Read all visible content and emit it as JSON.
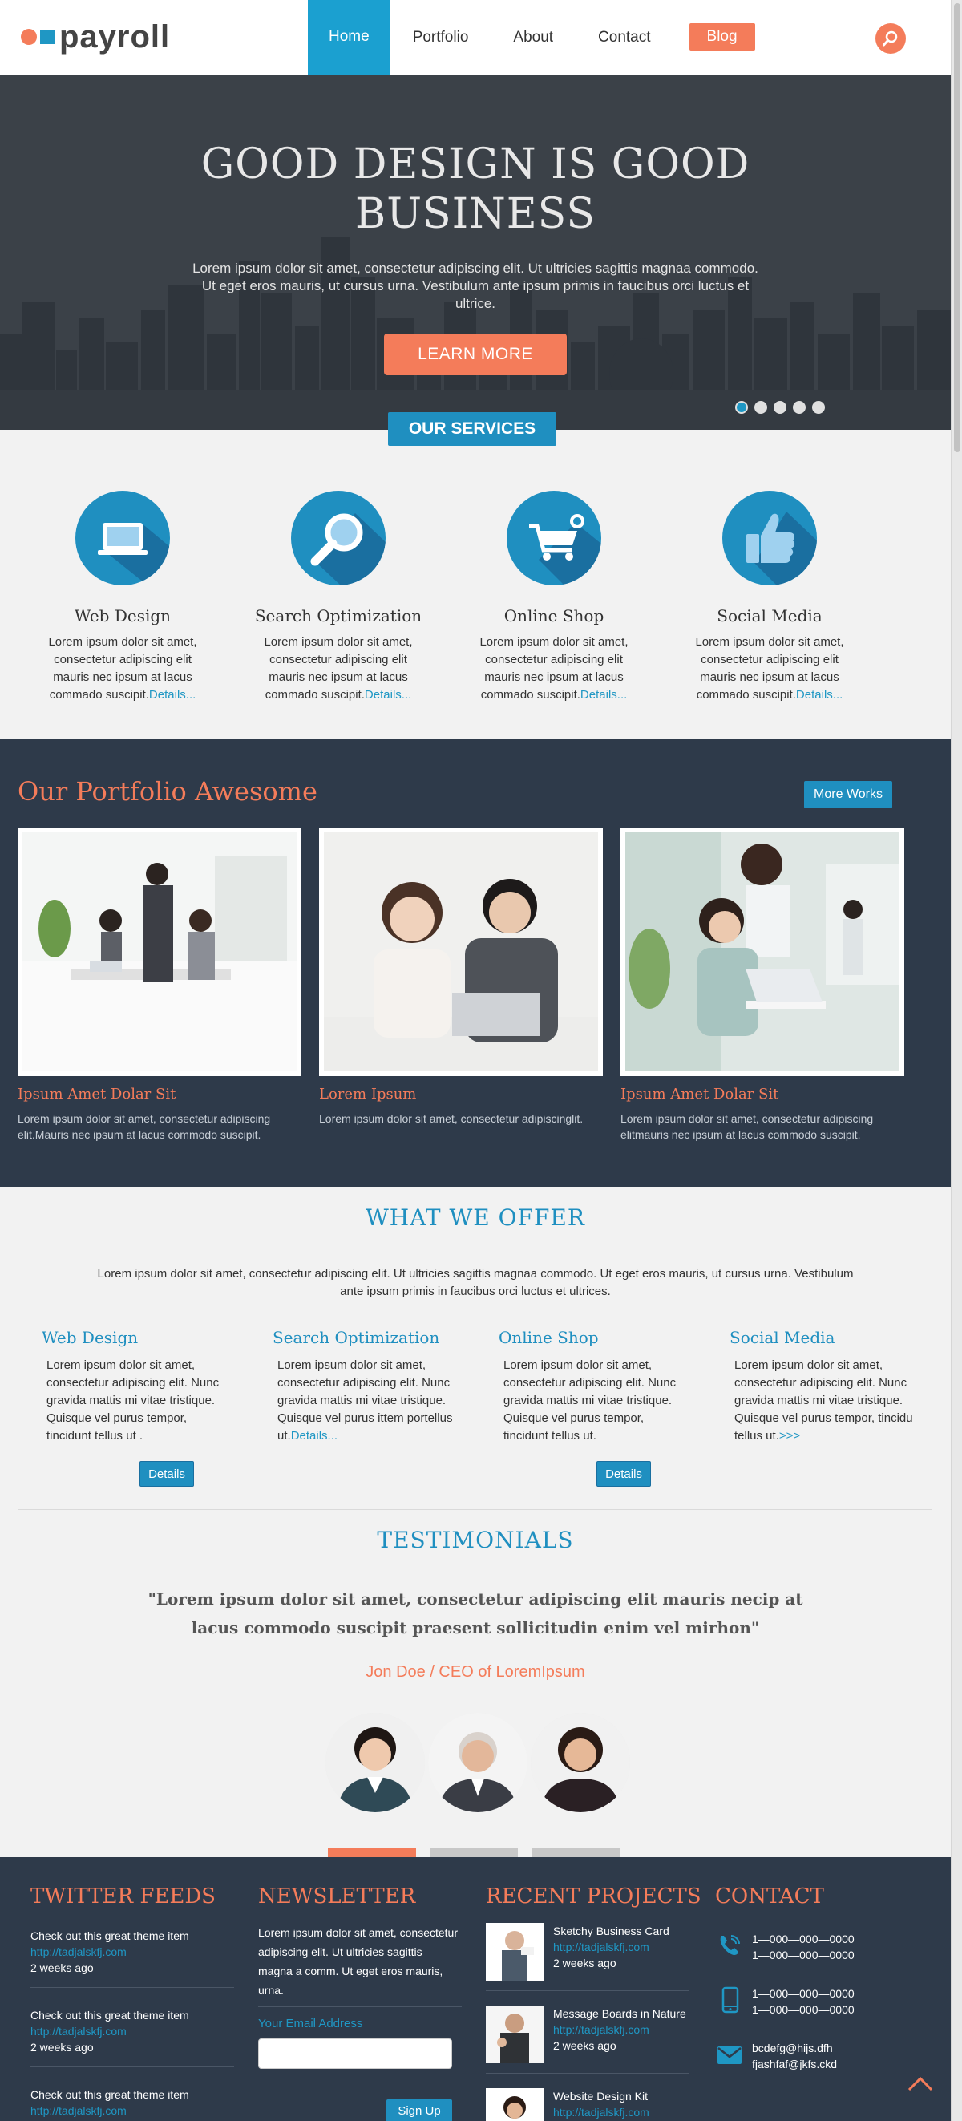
{
  "brand": {
    "name": "payroll"
  },
  "nav": {
    "home": "Home",
    "portfolio": "Portfolio",
    "about": "About",
    "contact": "Contact",
    "blog": "Blog"
  },
  "hero": {
    "title_line1": "GOOD DESIGN IS GOOD",
    "title_line2": "BUSINESS",
    "text": "Lorem ipsum dolor sit amet, consectetur adipiscing elit. Ut ultricies sagittis magnaa commodo. Ut eget eros mauris, ut cursus urna. Vestibulum ante ipsum primis in faucibus orci luctus et ultrice.",
    "cta": "LEARN MORE"
  },
  "services": {
    "tab": "OUR SERVICES",
    "items": [
      {
        "title": "Web Design",
        "text": "Lorem ipsum dolor sit amet, consectetur adipiscing elit mauris nec ipsum at lacus commado suscipit.",
        "link": "Details..."
      },
      {
        "title": "Search Optimization",
        "text": "Lorem ipsum dolor sit amet, consectetur adipiscing elit mauris nec ipsum at lacus commado suscipit.",
        "link": "Details..."
      },
      {
        "title": "Online Shop",
        "text": "Lorem ipsum dolor sit amet, consectetur adipiscing elit mauris nec ipsum at lacus commado suscipit.",
        "link": "Details..."
      },
      {
        "title": "Social Media",
        "text": "Lorem ipsum dolor sit amet, consectetur adipiscing elit mauris nec ipsum at lacus commado suscipit.",
        "link": "Details..."
      }
    ]
  },
  "portfolio": {
    "title": "Our Portfolio Awesome",
    "more": "More Works",
    "items": [
      {
        "title": "Ipsum Amet Dolar Sit",
        "text": "Lorem ipsum dolor sit amet, consectetur adipiscing elit.Mauris nec ipsum at lacus commodo suscipit."
      },
      {
        "title": "Lorem Ipsum",
        "text": "Lorem ipsum dolor sit amet, consectetur adipiscinglit."
      },
      {
        "title": "Ipsum Amet Dolar Sit",
        "text": "Lorem ipsum dolor sit amet, consectetur adipiscing elitmauris nec ipsum at lacus commodo suscipit."
      }
    ]
  },
  "offer": {
    "title": "WHAT WE OFFER",
    "intro": "Lorem ipsum dolor sit amet, consectetur adipiscing elit. Ut ultricies sagittis magnaa commodo. Ut eget eros mauris, ut cursus urna. Vestibulum ante ipsum primis in faucibus orci luctus et ultrices.",
    "cols": [
      {
        "title": "Web Design",
        "text": "Lorem ipsum dolor sit amet, consectetur adipiscing elit. Nunc gravida mattis mi vitae tristique. Quisque vel purus tempor, tincidunt tellus ut .",
        "link": ""
      },
      {
        "title": "Search Optimization",
        "text": "Lorem ipsum dolor sit amet, consectetur adipiscing elit. Nunc gravida mattis mi vitae tristique. Quisque vel purus ittem portellus ut.",
        "link": "Details..."
      },
      {
        "title": "Online Shop",
        "text": "Lorem ipsum dolor sit amet, consectetur adipiscing elit. Nunc gravida mattis mi vitae tristique. Quisque vel purus tempor, tincidunt tellus ut.",
        "link": ""
      },
      {
        "title": "Social Media",
        "text": "Lorem ipsum dolor sit amet, consectetur adipiscing elit. Nunc gravida mattis mi vitae tristique. Quisque vel purus tempor, tincidu tellus ut.",
        "link": ">>>"
      }
    ],
    "details": "Details"
  },
  "testimonials": {
    "title": "TESTIMONIALS",
    "quote_line1": "\"Lorem ipsum dolor sit amet, consectetur adipiscing elit mauris necip at",
    "quote_line2": "lacus commodo suscipit praesent sollicitudin enim vel mirhon\"",
    "author": "Jon Doe / CEO of LoremIpsum"
  },
  "footer": {
    "twitter": {
      "title": "TWITTER FEEDS",
      "items": [
        {
          "text": "Check out this great theme item",
          "link": "http://tadjalskfj.com",
          "time": "2 weeks ago"
        },
        {
          "text": "Check out this great theme item",
          "link": "http://tadjalskfj.com",
          "time": "2 weeks ago"
        },
        {
          "text": "Check out this great theme item",
          "link": "http://tadjalskfj.com",
          "time": ""
        }
      ]
    },
    "newsletter": {
      "title": "NEWSLETTER",
      "text": "Lorem ipsum dolor sit amet, consectetur adipiscing elit. Ut ultricies sagittis magna a comm. Ut eget eros mauris, urna.",
      "label": "Your Email Address",
      "placeholder": "",
      "button": "Sign Up"
    },
    "projects": {
      "title": "RECENT PROJECTS",
      "items": [
        {
          "name": "Sketchy Business Card",
          "link": "http://tadjalskfj.com",
          "time": "2 weeks ago"
        },
        {
          "name": "Message Boards in Nature",
          "link": "http://tadjalskfj.com",
          "time": "2 weeks ago"
        },
        {
          "name": "Website Design Kit",
          "link": "http://tadjalskfj.com",
          "time": ""
        }
      ]
    },
    "contact": {
      "title": "CONTACT",
      "phone1": "1—000—000—0000",
      "phone2": "1—000—000—0000",
      "mobile1": "1—000—000—0000",
      "mobile2": "1—000—000—0000",
      "email1": "bcdefg@hijs.dfh",
      "email2": "fjashfaf@jkfs.ckd"
    }
  },
  "colors": {
    "accent": "#f47c5a",
    "primary": "#1f8fc0",
    "dark": "#2e3a4a"
  }
}
